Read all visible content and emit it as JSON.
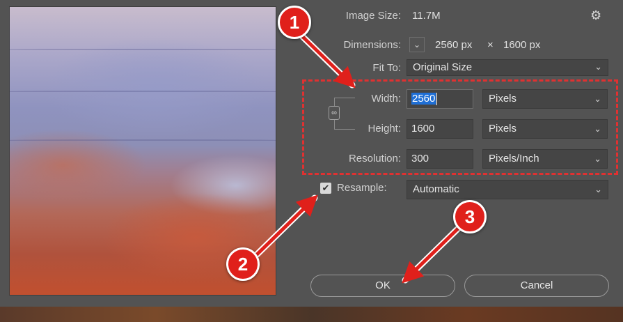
{
  "dialog": {
    "image_size": {
      "label": "Image Size:",
      "value": "11.7M"
    },
    "dimensions": {
      "label": "Dimensions:",
      "width": "2560 px",
      "sep": "×",
      "height": "1600 px"
    },
    "fit_to": {
      "label": "Fit To:",
      "value": "Original Size"
    },
    "width": {
      "label": "Width:",
      "value": "2560",
      "unit": "Pixels"
    },
    "height": {
      "label": "Height:",
      "value": "1600",
      "unit": "Pixels"
    },
    "resolution": {
      "label": "Resolution:",
      "value": "300",
      "unit": "Pixels/Inch"
    },
    "resample": {
      "label": "Resample:",
      "checked": true,
      "value": "Automatic"
    },
    "buttons": {
      "ok": "OK",
      "cancel": "Cancel"
    }
  },
  "annotations": {
    "badges": [
      "1",
      "2",
      "3"
    ],
    "accent_color": "#e0201b"
  },
  "icons": {
    "gear": "gear-icon",
    "chevron": "chevron-down-icon",
    "link": "chain-link-icon",
    "check": "checkmark-icon"
  }
}
